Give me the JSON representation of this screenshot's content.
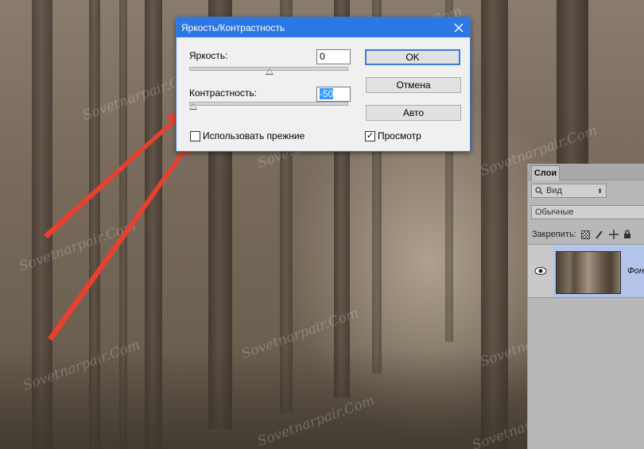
{
  "dialog": {
    "title": "Яркость/Контрастность",
    "brightness_label": "Яркость:",
    "brightness_value": "0",
    "brightness_level": 0.5,
    "contrast_label": "Контрастность:",
    "contrast_value": "-50",
    "contrast_level": 0.0,
    "ok_label": "OK",
    "cancel_label": "Отмена",
    "auto_label": "Авто",
    "legacy_label": "Использовать прежние",
    "legacy_checked": false,
    "preview_label": "Просмотр",
    "preview_checked": true,
    "colors": {
      "titlebar": "#2b78e4",
      "arrow": "#e8402f"
    }
  },
  "layers_panel": {
    "tab_label": "Слои",
    "filter_label": "Вид",
    "blend_mode": "Обычные",
    "lock_label": "Закрепить:",
    "layers": [
      {
        "name": "Фон",
        "visible": true
      }
    ]
  },
  "watermark": "Sovetnarpair.Com"
}
